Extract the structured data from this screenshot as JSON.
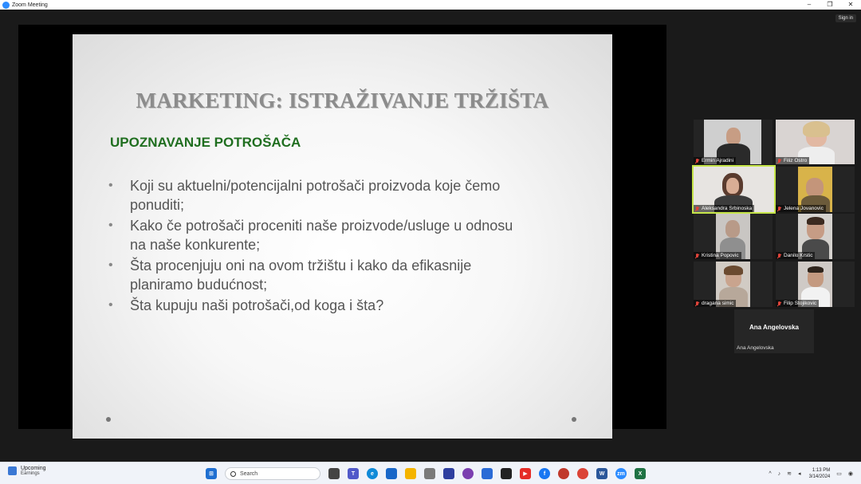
{
  "window": {
    "title": "Zoom Meeting",
    "controls": [
      "–",
      "❐",
      "✕"
    ]
  },
  "meeting": {
    "signin_label": "Sign in"
  },
  "slide": {
    "title": "MARKETING: ISTRAŽIVANJE TRŽIŠTA",
    "subtitle": "UPOZNAVANJE POTROŠAČA",
    "bullets": [
      {
        "l1": "Koji su aktuelni/potencijalni potrošači  proizvoda koje čemo",
        "l2": "ponuditi;"
      },
      {
        "l1": "Kako če potrošači proceniti naše proizvode/usluge u odnosu",
        "l2": "na naše  konkurente;"
      },
      {
        "l1": "Šta procenjuju oni na ovom tržištu i kako da efikasnije",
        "l2": "planiramo budućnost;"
      },
      {
        "l1": "Šta kupuju naši potrošači,od koga i šta?",
        "l2": ""
      }
    ],
    "bullet_glyph": "•"
  },
  "participants": [
    {
      "name": "Ermin Ajradini"
    },
    {
      "name": "Filiz Ostro"
    },
    {
      "name": "Aleksandra Srbinoska"
    },
    {
      "name": "Jelena Jovanovic"
    },
    {
      "name": "Kristina Popovic"
    },
    {
      "name": "Danilo Krstic"
    },
    {
      "name": "dragana simic"
    },
    {
      "name": "Filip Stojikovic"
    },
    {
      "name": "Ana Angelovska"
    }
  ],
  "taskbar": {
    "weather_title": "Upcoming",
    "weather_sub": "Earnings",
    "search_placeholder": "Search",
    "tray_up": "^",
    "time": "1:13 PM",
    "date": "3/14/2024",
    "colors": {
      "teams": "#5059c9",
      "edge": "#0f8ad8",
      "folder": "#f4b400",
      "word": "#2b579a",
      "excel": "#1f7244",
      "zoom": "#2D8CFF"
    }
  }
}
